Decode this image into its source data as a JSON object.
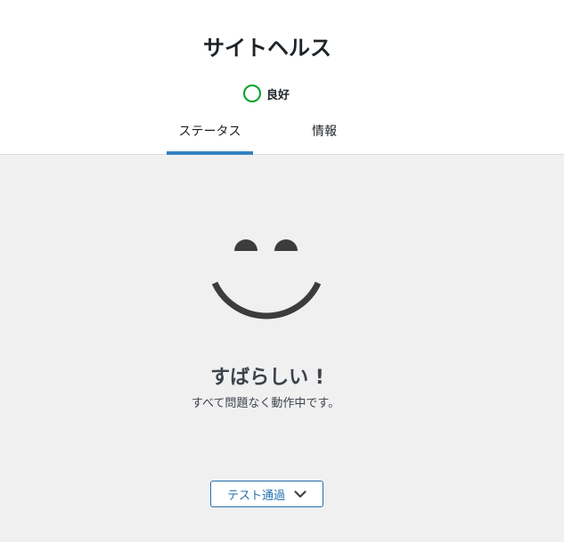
{
  "header": {
    "title": "サイトヘルス",
    "status_label": "良好",
    "status_color": "#00a32a"
  },
  "tabs": [
    {
      "label": "ステータス",
      "active": true
    },
    {
      "label": "情報",
      "active": false
    }
  ],
  "result": {
    "icon": "smiley-face-icon",
    "title": "すばらしい !",
    "subtitle": "すべて問題なく動作中です。"
  },
  "passed_tests_button": {
    "label": "テスト通過",
    "icon": "chevron-down-icon"
  },
  "colors": {
    "accent": "#3582c4",
    "text": "#1d2327",
    "button": "#2271b1",
    "smiley": "#3c3c3c",
    "background": "#f0f0f1"
  }
}
